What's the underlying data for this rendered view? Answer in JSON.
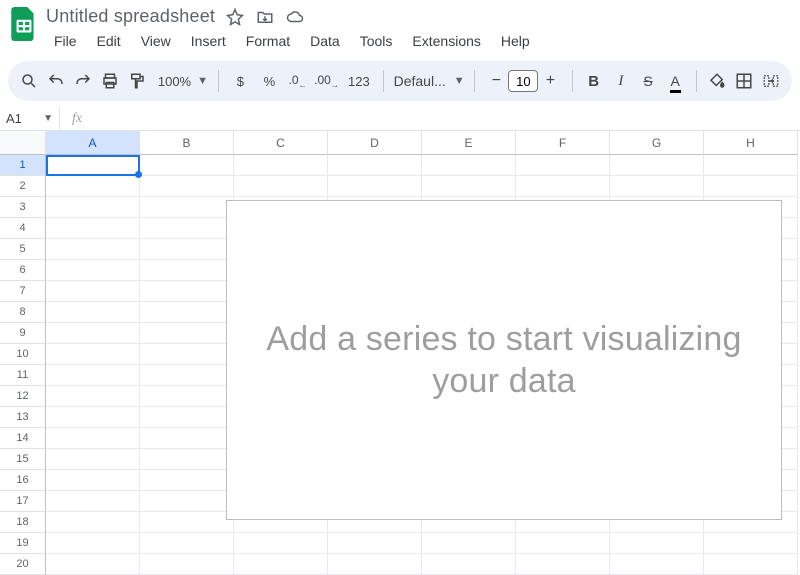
{
  "doc": {
    "title": "Untitled spreadsheet"
  },
  "menus": [
    "File",
    "Edit",
    "View",
    "Insert",
    "Format",
    "Data",
    "Tools",
    "Extensions",
    "Help"
  ],
  "toolbar": {
    "zoom": "100%",
    "currency": "$",
    "percent": "%",
    "dec_less": ".0",
    "dec_more": ".00",
    "num_fmt": "123",
    "font": "Defaul...",
    "font_size": "10",
    "minus": "−",
    "plus": "+"
  },
  "namebox": "A1",
  "fx": "fx",
  "columns": [
    "A",
    "B",
    "C",
    "D",
    "E",
    "F",
    "G",
    "H"
  ],
  "rows": [
    "1",
    "2",
    "3",
    "4",
    "5",
    "6",
    "7",
    "8",
    "9",
    "10",
    "11",
    "12",
    "13",
    "14",
    "15",
    "16",
    "17",
    "18",
    "19",
    "20"
  ],
  "selected": {
    "col": 0,
    "row": 0
  },
  "chart": {
    "placeholder": "Add a series to start visualizing your data"
  }
}
